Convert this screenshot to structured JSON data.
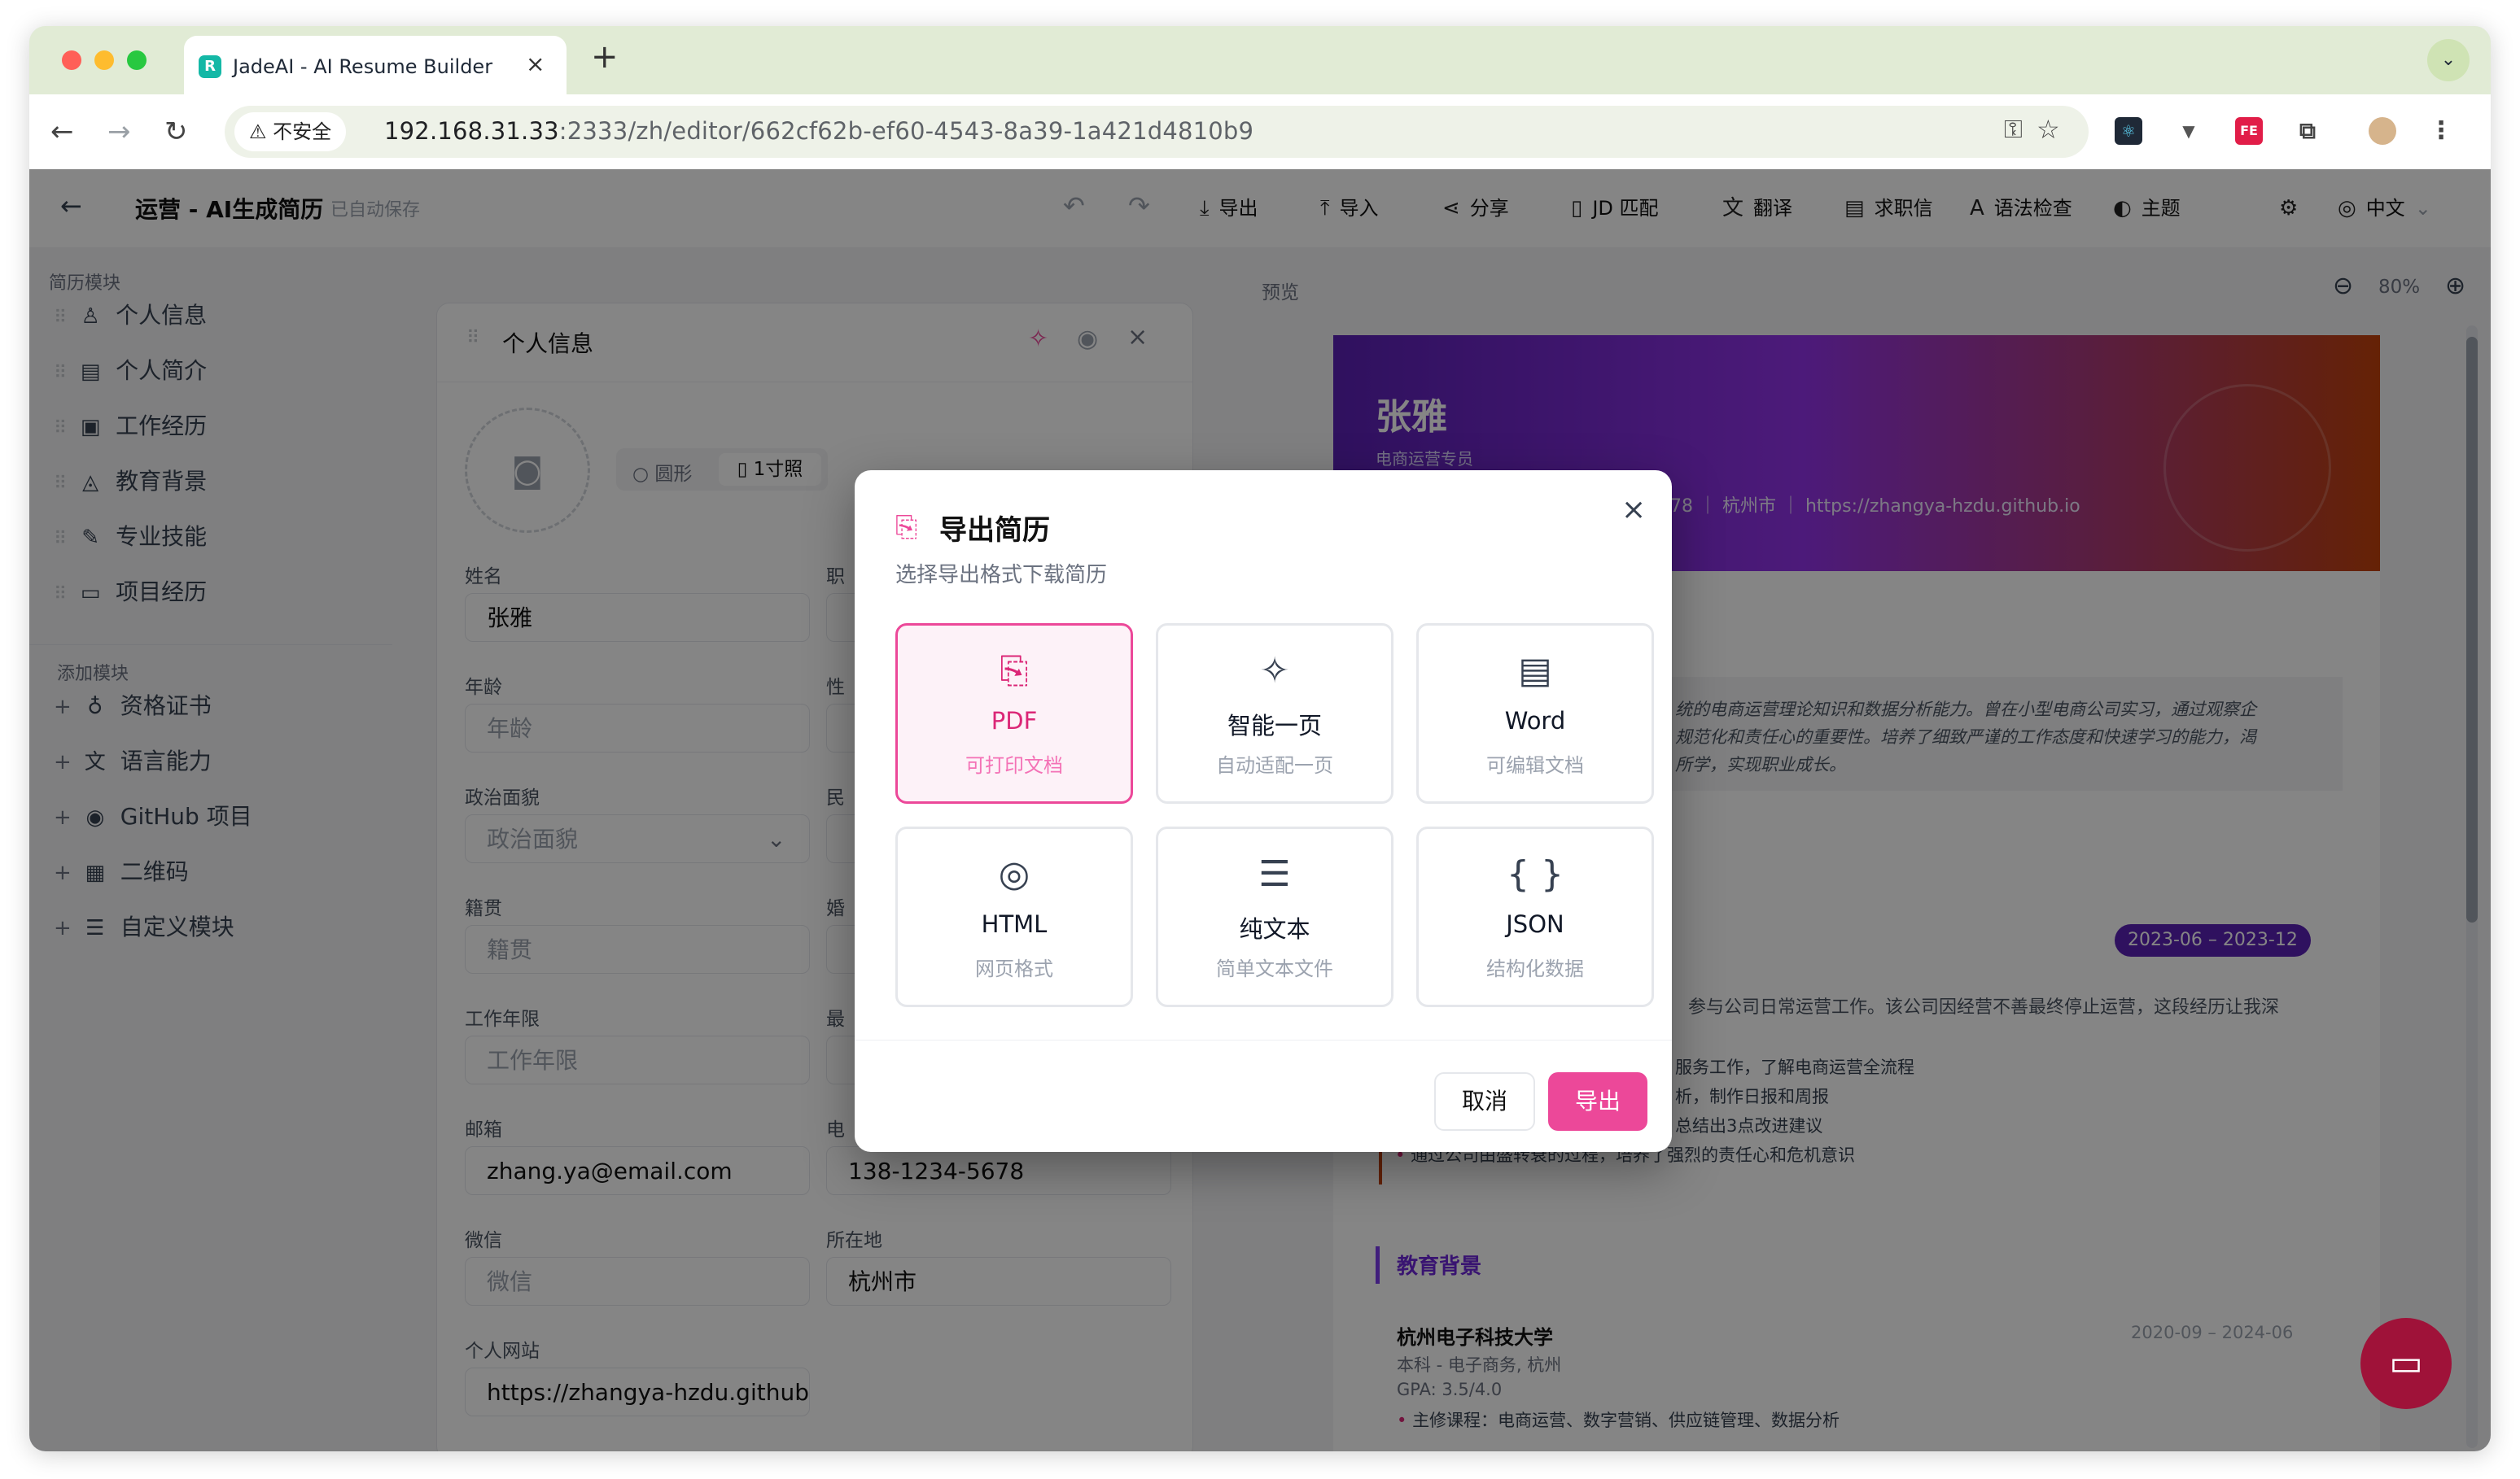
{
  "browser": {
    "tab_title": "JadeAI - AI Resume Builder",
    "tab_icon": "R",
    "new_tab": "+",
    "close_tab": "×",
    "insecure_label": "不安全",
    "url_host": "192.168.31.33",
    "url_rest": ":2333/zh/editor/662cf62b-ef60-4543-8a39-1a421d4810b9",
    "extension_fe": "FE"
  },
  "header": {
    "title": "运营 - AI生成简历",
    "autosave": "已自动保存",
    "actions": [
      "导出",
      "导入",
      "分享",
      "JD 匹配",
      "翻译",
      "求职信",
      "语法检查",
      "主题"
    ],
    "language": "中文"
  },
  "sidebar": {
    "section1": "简历模块",
    "modules": [
      "个人信息",
      "个人简介",
      "工作经历",
      "教育背景",
      "专业技能",
      "项目经历"
    ],
    "section2": "添加模块",
    "add_modules": [
      "资格证书",
      "语言能力",
      "GitHub 项目",
      "二维码",
      "自定义模块"
    ]
  },
  "editor": {
    "card_title": "个人信息",
    "photo_shape_circle": "圆形",
    "photo_shape_portrait": "1寸照",
    "fields": {
      "name_label": "姓名",
      "name_value": "张雅",
      "title_label": "职",
      "age_label": "年龄",
      "age_placeholder": "年龄",
      "gender_label": "性",
      "political_label": "政治面貌",
      "political_placeholder": "政治面貌",
      "ethnic_label": "民",
      "hometown_label": "籍贯",
      "hometown_placeholder": "籍贯",
      "marital_label": "婚",
      "years_label": "工作年限",
      "years_placeholder": "工作年限",
      "salary_label": "最",
      "email_label": "邮箱",
      "email_value": "zhang.ya@email.com",
      "phone_label": "电",
      "phone_value": "138-1234-5678",
      "wechat_label": "微信",
      "wechat_placeholder": "微信",
      "location_label": "所在地",
      "location_value": "杭州市",
      "website_label": "个人网站",
      "website_value": "https://zhangya-hzdu.github"
    }
  },
  "preview": {
    "label": "预览",
    "zoom": "80%",
    "name": "张雅",
    "subtitle": "电商运营专员",
    "contact_tail": "678 ｜ 杭州市 ｜ https://zhangya-hzdu.github.io",
    "summary_lines": [
      "统的电商运营理论知识和数据分析能力。曾在小型电商公司实习，通过观察企",
      "规范化和责任心的重要性。培养了细致严谨的工作态度和快速学习的能力，渴",
      "所学，实现职业成长。"
    ],
    "job_date": "2023-06 – 2023-12",
    "job_desc": "参与公司日常运营工作。该公司因经营不善最终停止运营，这段经历让我深",
    "job_bullets": [
      "服务工作，了解电商运营全流程",
      "析，制作日报和周报",
      "总结出3点改进建议",
      "通过公司由盛转衰的过程，培养了强烈的责任心和危机意识"
    ],
    "edu_heading": "教育背景",
    "school": "杭州电子科技大学",
    "school_date": "2020-09 – 2024-06",
    "degree": "本科 - 电子商务, 杭州",
    "gpa": "GPA: 3.5/4.0",
    "courses": "主修课程：电商运营、数字营销、供应链管理、数据分析"
  },
  "dialog": {
    "title": "导出简历",
    "subtitle": "选择导出格式下载简历",
    "formats": [
      {
        "name": "PDF",
        "desc": "可打印文档",
        "icon": "file-download-icon",
        "selected": true
      },
      {
        "name": "智能一页",
        "desc": "自动适配一页",
        "icon": "sparkles-icon",
        "selected": false
      },
      {
        "name": "Word",
        "desc": "可编辑文档",
        "icon": "file-text-icon",
        "selected": false
      },
      {
        "name": "HTML",
        "desc": "网页格式",
        "icon": "globe-icon",
        "selected": false
      },
      {
        "name": "纯文本",
        "desc": "简单文本文件",
        "icon": "align-left-icon",
        "selected": false
      },
      {
        "name": "JSON",
        "desc": "结构化数据",
        "icon": "braces-icon",
        "selected": false
      }
    ],
    "cancel_label": "取消",
    "export_label": "导出"
  },
  "colors": {
    "accent": "#ec4899",
    "banner_start": "#5b21b6",
    "banner_end": "#c2410c",
    "tabbar": "#e1ebd5"
  }
}
